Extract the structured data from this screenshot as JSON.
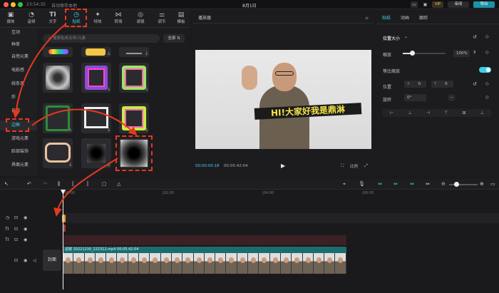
{
  "topbar": {
    "time": "23:54:35",
    "autosave": "自动保存本地",
    "date": "8月1日",
    "vip": "VIP",
    "review": "审阅",
    "export": "导出"
  },
  "toolbar": {
    "items": [
      {
        "label": "媒体",
        "icon": "media-icon"
      },
      {
        "label": "音频",
        "icon": "audio-icon"
      },
      {
        "label": "文字",
        "icon": "text-icon",
        "glyph": "TI"
      },
      {
        "label": "贴纸",
        "icon": "sticker-icon",
        "active": true
      },
      {
        "label": "特效",
        "icon": "effects-icon"
      },
      {
        "label": "转场",
        "icon": "transition-icon"
      },
      {
        "label": "滤镜",
        "icon": "filter-icon"
      },
      {
        "label": "调节",
        "icon": "adjust-icon"
      },
      {
        "label": "模板",
        "icon": "template-icon"
      }
    ]
  },
  "categories": [
    "互动",
    "种草",
    "自然元素",
    "电影感",
    "线条风",
    "炸",
    "日常",
    "边框",
    "游戏元素",
    "脸部装饰",
    "界面元素"
  ],
  "active_category": "边框",
  "search": {
    "placeholder": "搜索贴纸名称/元素",
    "all_label": "全部"
  },
  "player": {
    "title": "播放器",
    "current_time": "00:00:00:18",
    "total_time": "00:05:42:04",
    "caption": "HI!大家好我是鼎淋"
  },
  "right": {
    "tabs": [
      "贴纸",
      "动画",
      "跟踪"
    ],
    "section": "位置大小",
    "scale_label": "缩放",
    "scale_value": "100%",
    "uniform_label": "等比缩放",
    "position_label": "位置",
    "x_label": "X",
    "x_value": "0",
    "y_label": "Y",
    "y_value": "0",
    "rotate_label": "旋转",
    "rotate_value": "0°"
  },
  "timeline": {
    "ticks": [
      "00:00",
      "|02:00",
      "|04:00",
      "|06:00"
    ],
    "clip_label": "滤镜 20221230_222312.mp4 00:05:42:04",
    "cover_label": "封面"
  },
  "colors": {
    "accent": "#3fd0e6",
    "annotation": "#e8381e"
  }
}
